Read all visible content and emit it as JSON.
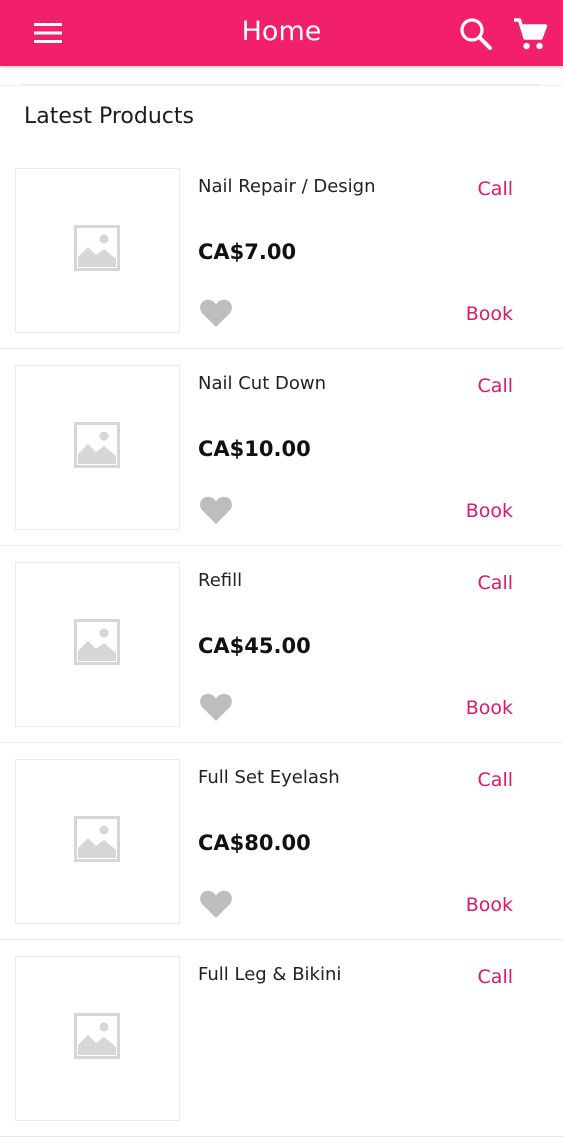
{
  "appbar": {
    "title": "Home",
    "menu_icon": "menu-icon",
    "search_icon": "search-icon",
    "cart_icon": "cart-icon",
    "color": "#f21f6b"
  },
  "section": {
    "title": "Latest Products"
  },
  "products": [
    {
      "name": "Nail Repair / Design",
      "price": "CA$7.00",
      "call": "Call",
      "book": "Book"
    },
    {
      "name": "Nail Cut Down",
      "price": "CA$10.00",
      "call": "Call",
      "book": "Book"
    },
    {
      "name": "Refill",
      "price": "CA$45.00",
      "call": "Call",
      "book": "Book"
    },
    {
      "name": "Full Set Eyelash",
      "price": "CA$80.00",
      "call": "Call",
      "book": "Book"
    },
    {
      "name": "Full Leg & Bikini",
      "price": "",
      "call": "Call",
      "book": ""
    }
  ],
  "colors": {
    "accent": "#e0176a",
    "heart": "#bdbdbd",
    "placeholder": "#d6d6d6"
  }
}
